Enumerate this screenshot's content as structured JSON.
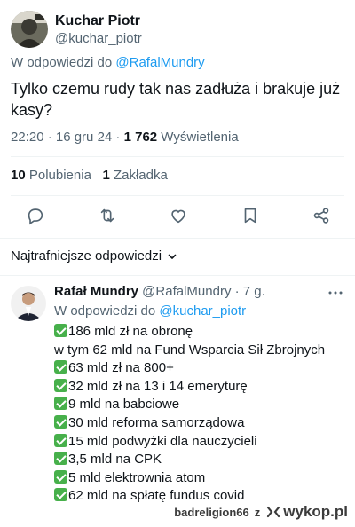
{
  "tweet": {
    "author_name": "Kuchar Piotr",
    "author_handle": "@kuchar_piotr",
    "reply_to_prefix": "W odpowiedzi do ",
    "reply_to_mention": "@RafalMundry",
    "text": "Tylko czemu rudy tak nas zadłuża i brakuje już kasy?",
    "time": "22:20 · 16 gru 24 · ",
    "views_count": "1 762",
    "views_label": " Wyświetlenia",
    "likes_count": "10",
    "likes_label": " Polubienia",
    "bookmarks_count": "1",
    "bookmarks_label": " Zakładka"
  },
  "actions": {
    "reply_icon": "reply-icon",
    "retweet_icon": "retweet-icon",
    "like_icon": "heart-icon",
    "bookmark_icon": "bookmark-icon",
    "share_icon": "share-icon"
  },
  "replies_sort": {
    "label": "Najtrafniejsze odpowiedzi"
  },
  "reply": {
    "author_name": "Rafał Mundry",
    "author_handle_time": " @RafalMundry · 7 g.",
    "reply_to_prefix": "W odpowiedzi do ",
    "reply_to_mention": "@kuchar_piotr",
    "lines": [
      "186 mld zł na obronę",
      "w tym 62 mld na Fund Wsparcia Sił Zbrojnych",
      "63 mld zł na 800+",
      "32 mld zł na 13 i 14 emeryturę",
      "9 mld na babciowe",
      "30 mld reforma samorządowa",
      "15 mld podwyżki dla nauczycieli",
      "3,5 mld na CPK",
      "5 mld elektrownia atom",
      "62 mld na spłatę fundus covid"
    ]
  },
  "watermark": {
    "user": "badreligion66",
    "conj": "z",
    "site": "wykop.pl"
  },
  "colors": {
    "accent": "#1d9bf0",
    "muted": "#536471",
    "check": "#47b04b"
  }
}
